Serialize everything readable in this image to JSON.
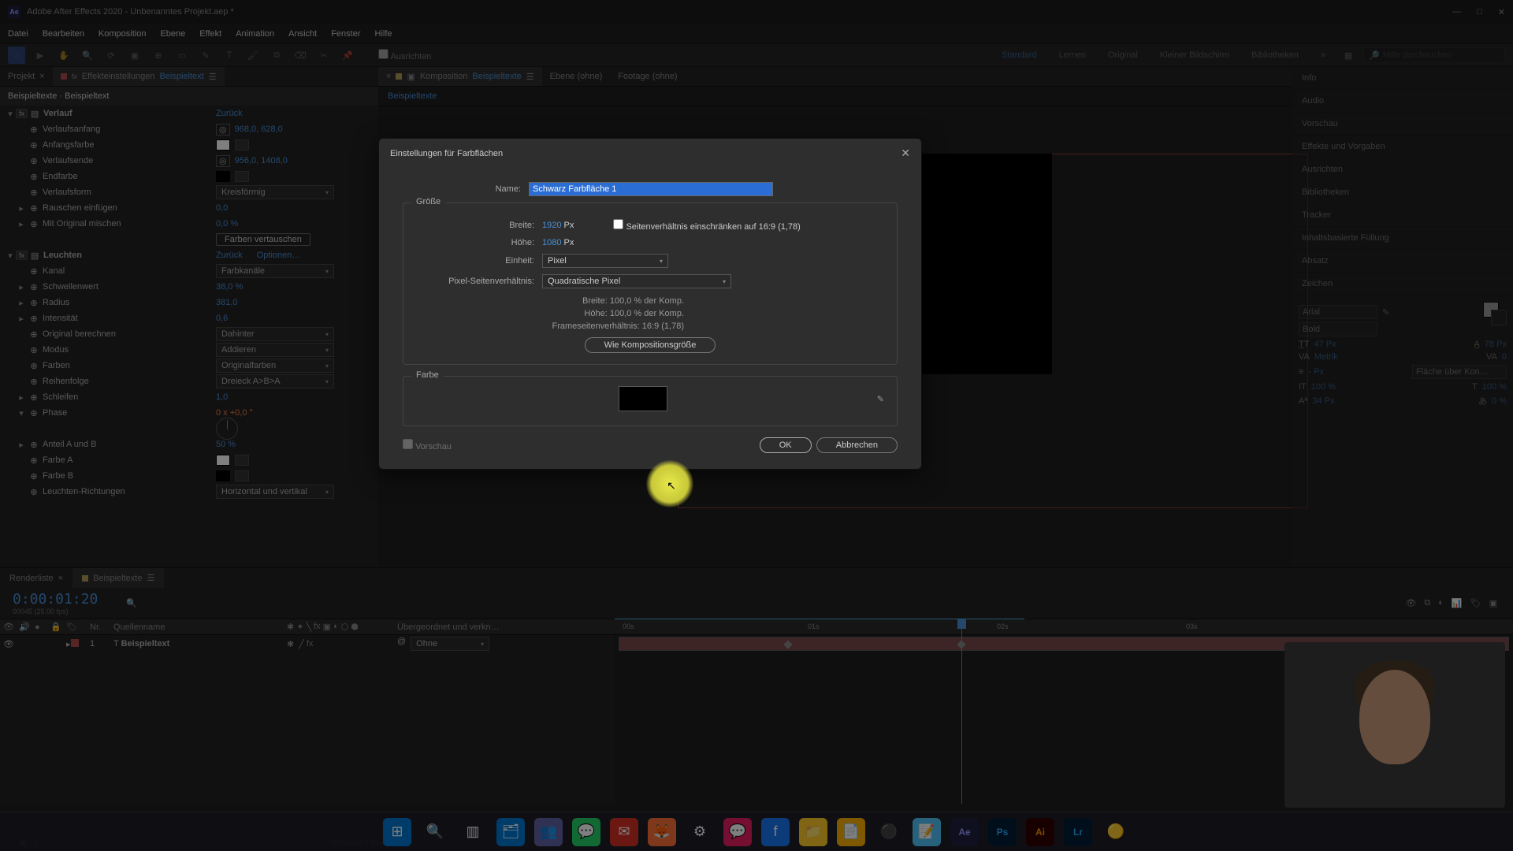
{
  "titlebar": {
    "app": "Adobe After Effects 2020 - Unbenanntes Projekt.aep *"
  },
  "menu": [
    "Datei",
    "Bearbeiten",
    "Komposition",
    "Ebene",
    "Effekt",
    "Animation",
    "Ansicht",
    "Fenster",
    "Hilfe"
  ],
  "toolbar": {
    "ausrichten": "Ausrichten",
    "workspaces": {
      "active": "Standard",
      "others": [
        "Lernen",
        "Original",
        "Kleiner Bildschirm",
        "Bibliotheken"
      ]
    },
    "search_placeholder": "Hilfe durchsuchen"
  },
  "left_tabs": {
    "projekt": "Projekt",
    "fx": "Effekteinstellungen",
    "fx_target": "Beispieltext"
  },
  "fx": {
    "header": "Beispieltexte · Beispieltext",
    "verlauf": {
      "title": "Verlauf",
      "reset": "Zurück",
      "anfang_name": "Verlaufsanfang",
      "anfang_val": "968,0, 628,0",
      "anfangsfarbe": "Anfangsfarbe",
      "ende_name": "Verlaufsende",
      "ende_val": "956,0, 1408,0",
      "endfarbe": "Endfarbe",
      "form_name": "Verlaufsform",
      "form_val": "Kreisförmig",
      "rauschen_name": "Rauschen einfügen",
      "rauschen_val": "0,0",
      "mischen_name": "Mit Original mischen",
      "mischen_val": "0,0 %",
      "swap": "Farben vertauschen"
    },
    "leuchten": {
      "title": "Leuchten",
      "reset": "Zurück",
      "opts": "Optionen…",
      "kanal_name": "Kanal",
      "kanal_val": "Farbkanäle",
      "schwelle_name": "Schwellenwert",
      "schwelle_val": "38,0 %",
      "radius_name": "Radius",
      "radius_val": "381,0",
      "intens_name": "Intensität",
      "intens_val": "0,6",
      "orig_name": "Original berechnen",
      "orig_val": "Dahinter",
      "modus_name": "Modus",
      "modus_val": "Addieren",
      "farben_name": "Farben",
      "farben_val": "Originalfarben",
      "reihen_name": "Reihenfolge",
      "reihen_val": "Dreieck A>B>A",
      "schleifen_name": "Schleifen",
      "schleifen_val": "1,0",
      "phase_name": "Phase",
      "phase_val": "0 x +0,0 °",
      "anteil_name": "Anteil A und B",
      "anteil_val": "50 %",
      "farbeA": "Farbe A",
      "farbeB": "Farbe B",
      "richt_name": "Leuchten-Richtungen",
      "richt_val": "Horizontal und vertikal"
    }
  },
  "comp_tabs": {
    "comp_label": "Komposition",
    "comp_name": "Beispieltexte",
    "ebene": "Ebene (ohne)",
    "footage": "Footage (ohne)"
  },
  "breadcrumb": "Beispieltexte",
  "right": {
    "panels": [
      "Info",
      "Audio",
      "Vorschau",
      "Effekte und Vorgaben",
      "Ausrichten",
      "Bibliotheken",
      "Tracker",
      "Inhaltsbasierte Füllung",
      "Absatz",
      "Zeichen"
    ],
    "font": "Arial",
    "weight": "Bold",
    "size": "47 Px",
    "leading": "78 Px",
    "kerning": "Metrik",
    "tracking": "0",
    "stroke": "- Px",
    "fill_over": "Fläche über Kon…",
    "hscale": "100 %",
    "vscale": "100 %",
    "baseline": "34 Px",
    "tsume": "0 %"
  },
  "dialog": {
    "title": "Einstellungen für Farbflächen",
    "name_label": "Name:",
    "name_val": "Schwarz Farbfläche 1",
    "size_legend": "Größe",
    "width_label": "Breite:",
    "width_val": "1920",
    "px": "Px",
    "height_label": "Höhe:",
    "height_val": "1080",
    "lock_ratio": "Seitenverhältnis einschränken auf 16:9 (1,78)",
    "unit_label": "Einheit:",
    "unit_val": "Pixel",
    "par_label": "Pixel-Seitenverhältnis:",
    "par_val": "Quadratische Pixel",
    "info_w": "Breite:  100,0 % der Komp.",
    "info_h": "Höhe:  100,0 % der Komp.",
    "info_far": "Frameseitenverhältnis:  16:9 (1,78)",
    "compsize": "Wie Kompositionsgröße",
    "color_legend": "Farbe",
    "preview": "Vorschau",
    "ok": "OK",
    "cancel": "Abbrechen"
  },
  "timeline": {
    "render": "Renderliste",
    "comp": "Beispieltexte",
    "timecode": "0:00:01:20",
    "sub": "00045 (25.00 fps)",
    "cols": {
      "nr": "Nr.",
      "src": "Quellenname",
      "parent": "Übergeordnet und verkn…"
    },
    "layer_num": "1",
    "layer_name": "Beispieltext",
    "parent_val": "Ohne",
    "ruler": [
      "00s",
      "01s",
      "02s",
      "03s"
    ],
    "schalter": "Schalter / Modi"
  }
}
